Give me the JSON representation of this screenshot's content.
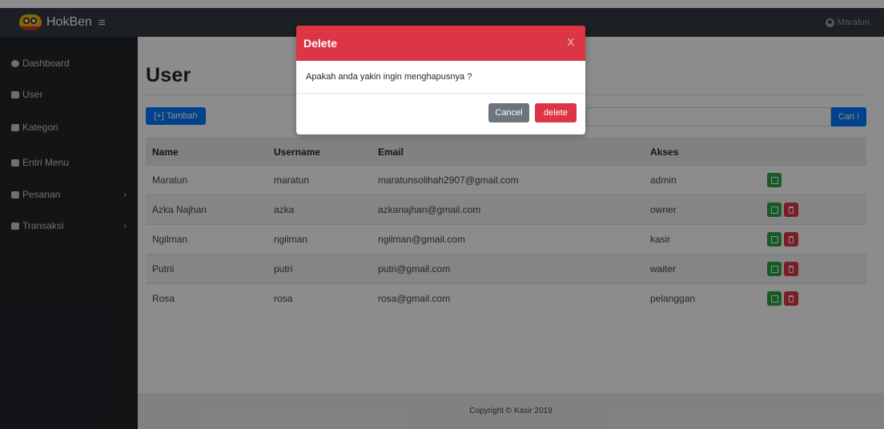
{
  "header": {
    "brand": "HokBen",
    "menu_icon": "hamburger-icon",
    "user_label": "Maratun"
  },
  "sidebar": {
    "items": [
      {
        "label": "Dashboard",
        "icon": "dashboard-icon"
      },
      {
        "label": "User",
        "icon": "users-icon"
      },
      {
        "label": "Kategori",
        "icon": "list-icon"
      },
      {
        "label": "Entri Menu",
        "icon": "utensils-icon"
      },
      {
        "label": "Pesanan",
        "icon": "cart-icon",
        "chevron": "›"
      },
      {
        "label": "Transaksi",
        "icon": "money-icon",
        "chevron": "›"
      }
    ]
  },
  "main": {
    "title": "User",
    "add_button": "[+] Tambah",
    "search": {
      "placeholder": "",
      "value": ""
    },
    "search_button": "Cari !",
    "table": {
      "headers": [
        "Name",
        "Username",
        "Email",
        "Akses",
        ""
      ],
      "rows": [
        {
          "name": "Maratun",
          "username": "maratun",
          "email": "maratunsolihah2907@gmail.com",
          "akses": "admin",
          "actions": [
            "edit"
          ]
        },
        {
          "name": "Azka Najhan",
          "username": "azka",
          "email": "azkanajhan@gmail.com",
          "akses": "owner",
          "actions": [
            "edit",
            "delete"
          ]
        },
        {
          "name": "Ngilman",
          "username": "ngilman",
          "email": "ngilman@gmail.com",
          "akses": "kasir",
          "actions": [
            "edit",
            "delete"
          ]
        },
        {
          "name": "Putrii",
          "username": "putri",
          "email": "putri@gmail.com",
          "akses": "waiter",
          "actions": [
            "edit",
            "delete"
          ]
        },
        {
          "name": "Rosa",
          "username": "rosa",
          "email": "rosa@gmail.com",
          "akses": "pelanggan",
          "actions": [
            "edit",
            "delete"
          ]
        }
      ]
    },
    "footer": "Copyright © Kasir 2019"
  },
  "modal": {
    "title": "Delete",
    "close": "X",
    "message": "Apakah anda yakin ingin menghapusnya ?",
    "cancel": "Cancel",
    "confirm": "delete"
  },
  "colors": {
    "sidebar": "#212529",
    "header": "#343a40",
    "primary": "#007bff",
    "danger": "#dc3545",
    "success": "#28a745",
    "secondary": "#6c757d"
  }
}
